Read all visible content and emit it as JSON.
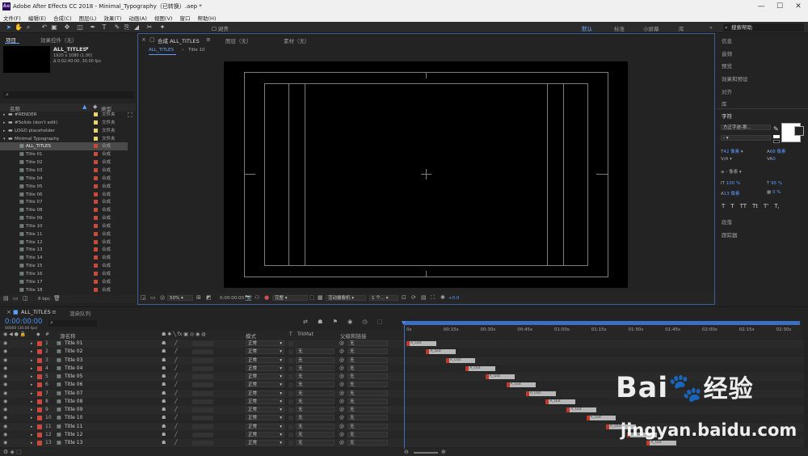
{
  "window": {
    "title": "Adobe After Effects CC 2018 - Minimal_Typography（已转换）.aep *",
    "logo": "Ae"
  },
  "menu": [
    "文件(F)",
    "编辑(E)",
    "合成(C)",
    "图层(L)",
    "效果(T)",
    "动画(A)",
    "视图(V)",
    "窗口",
    "帮助(H)"
  ],
  "toolbar": {
    "align_label": "对齐",
    "workspaces": [
      "默认",
      "标准",
      "小屏幕",
      "库"
    ],
    "search_placeholder": "搜索帮助",
    "icons": [
      "selection-tool-icon",
      "hand-tool-icon",
      "zoom-tool-icon",
      "rotate-tool-icon",
      "camera-tool-icon",
      "pan-tool-icon",
      "mask-tool-icon",
      "pen-tool-icon",
      "type-tool-icon",
      "brush-tool-icon",
      "clone-tool-icon",
      "eraser-tool-icon",
      "roto-tool-icon",
      "puppet-tool-icon"
    ]
  },
  "project": {
    "tab_project": "项目",
    "tab_effects": "效果控件（无）",
    "comp_name": "ALL_TITLES",
    "comp_meta1": "1920 x 1080 (1.00)",
    "comp_meta2": "Δ 0:02:40:00, 30.00 fps",
    "search_placeholder": "",
    "col_name": "名称",
    "col_type": "类型",
    "items": [
      {
        "name": "#RENDER",
        "type": "文件夹",
        "color": "#e8d46b",
        "folder": true
      },
      {
        "name": "#Solids (don't edit)",
        "type": "文件夹",
        "color": "#e8d46b",
        "folder": true
      },
      {
        "name": "LOGO placeholder",
        "type": "文件夹",
        "color": "#e8d46b",
        "folder": true
      },
      {
        "name": "Minimal Typography",
        "type": "文件夹",
        "color": "#e8d46b",
        "folder": true
      },
      {
        "name": "ALL_TITLES",
        "type": "合成",
        "color": "#c94a3c",
        "selected": true
      },
      {
        "name": "Title 01",
        "type": "合成",
        "color": "#c94a3c"
      },
      {
        "name": "Title 02",
        "type": "合成",
        "color": "#c94a3c"
      },
      {
        "name": "Title 03",
        "type": "合成",
        "color": "#c94a3c"
      },
      {
        "name": "Title 04",
        "type": "合成",
        "color": "#c94a3c"
      },
      {
        "name": "Title 05",
        "type": "合成",
        "color": "#c94a3c"
      },
      {
        "name": "Title 06",
        "type": "合成",
        "color": "#c94a3c"
      },
      {
        "name": "Title 07",
        "type": "合成",
        "color": "#c94a3c"
      },
      {
        "name": "Title 08",
        "type": "合成",
        "color": "#c94a3c"
      },
      {
        "name": "Title 09",
        "type": "合成",
        "color": "#c94a3c"
      },
      {
        "name": "Title 10",
        "type": "合成",
        "color": "#c94a3c"
      },
      {
        "name": "Title 11",
        "type": "合成",
        "color": "#c94a3c"
      },
      {
        "name": "Title 12",
        "type": "合成",
        "color": "#c94a3c"
      },
      {
        "name": "Title 13",
        "type": "合成",
        "color": "#c94a3c"
      },
      {
        "name": "Title 14",
        "type": "合成",
        "color": "#c94a3c"
      },
      {
        "name": "Title 15",
        "type": "合成",
        "color": "#c94a3c"
      },
      {
        "name": "Title 16",
        "type": "合成",
        "color": "#c94a3c"
      },
      {
        "name": "Title 17",
        "type": "合成",
        "color": "#c94a3c"
      },
      {
        "name": "Title 18",
        "type": "合成",
        "color": "#c94a3c"
      }
    ],
    "footer_bpc": "8 bpc"
  },
  "viewer": {
    "tab_comp": "合成 ALL_TITLES",
    "tab_layer": "图层（无）",
    "tab_footage": "素材（无）",
    "crumb_active": "ALL_TITLES",
    "crumb_next": "Title 10",
    "zoom": "50%",
    "timecode": "0:00:00:00",
    "resolution": "完整",
    "camera": "活动摄像机",
    "views": "1 个...",
    "exposure": "+0.0"
  },
  "right_panel": {
    "sections": [
      "信息",
      "音频",
      "预览",
      "效果和预设",
      "对齐",
      "库"
    ],
    "char_title": "字符",
    "font": "方正字迹-那...",
    "font_size": "42 像素",
    "leading": "68 像素",
    "tracking": "0",
    "indent": "- 像素",
    "vert_scale": "100 %",
    "horiz_scale": "95 %",
    "baseline": "13 像素",
    "tsume": "0 %",
    "type_styles": [
      "T",
      "T",
      "TT",
      "Tt",
      "T'",
      "T,"
    ],
    "para_title": "段落",
    "tracker_title": "跟踪器"
  },
  "timeline": {
    "tab_comp": "ALL_TITLES",
    "tab_render": "渲染队列",
    "timecode": "0:00:00:00",
    "frames": "00000 (30.00 fps)",
    "col_num": "#",
    "col_source": "源名称",
    "col_mode": "模式",
    "col_t": "T",
    "col_trkmat": "TrkMat",
    "col_parent": "父级和链接",
    "ruler": [
      "0s",
      "00:15s",
      "00:30s",
      "00:45s",
      "01:00s",
      "01:15s",
      "01:30s",
      "01:45s",
      "02:00s",
      "02:15s",
      "02:30s"
    ],
    "layers": [
      {
        "num": "1",
        "name": "Title 01",
        "mode": "正常",
        "trk": "",
        "parent": "无",
        "start": 0
      },
      {
        "num": "2",
        "name": "Title 02",
        "mode": "正常",
        "trk": "无",
        "parent": "无",
        "start": 8.0
      },
      {
        "num": "3",
        "name": "Title 03",
        "mode": "正常",
        "trk": "无",
        "parent": "无",
        "start": 16.0
      },
      {
        "num": "4",
        "name": "Title 04",
        "mode": "正常",
        "trk": "无",
        "parent": "无",
        "start": 24.0
      },
      {
        "num": "5",
        "name": "Title 05",
        "mode": "正常",
        "trk": "无",
        "parent": "无",
        "start": 32.0
      },
      {
        "num": "6",
        "name": "Title 06",
        "mode": "正常",
        "trk": "无",
        "parent": "无",
        "start": 40.5
      },
      {
        "num": "7",
        "name": "Title 07",
        "mode": "正常",
        "trk": "无",
        "parent": "无",
        "start": 48.5
      },
      {
        "num": "8",
        "name": "Title 08",
        "mode": "正常",
        "trk": "无",
        "parent": "无",
        "start": 56.5
      },
      {
        "num": "9",
        "name": "Title 09",
        "mode": "正常",
        "trk": "无",
        "parent": "无",
        "start": 65.0
      },
      {
        "num": "10",
        "name": "Title 10",
        "mode": "正常",
        "trk": "无",
        "parent": "无",
        "start": 73.0
      },
      {
        "num": "11",
        "name": "Title 11",
        "mode": "正常",
        "trk": "无",
        "parent": "无",
        "start": 81.0
      },
      {
        "num": "12",
        "name": "Title 12",
        "mode": "正常",
        "trk": "无",
        "parent": "无",
        "start": 89.5
      },
      {
        "num": "13",
        "name": "Title 13",
        "mode": "正常",
        "trk": "无",
        "parent": "无",
        "start": 97.5
      }
    ],
    "bar_label": "A_Out",
    "bar_length_s": 12
  },
  "watermark": {
    "brand": "Bai",
    "brand2": "经验",
    "url": "jingyan.baidu.com"
  }
}
